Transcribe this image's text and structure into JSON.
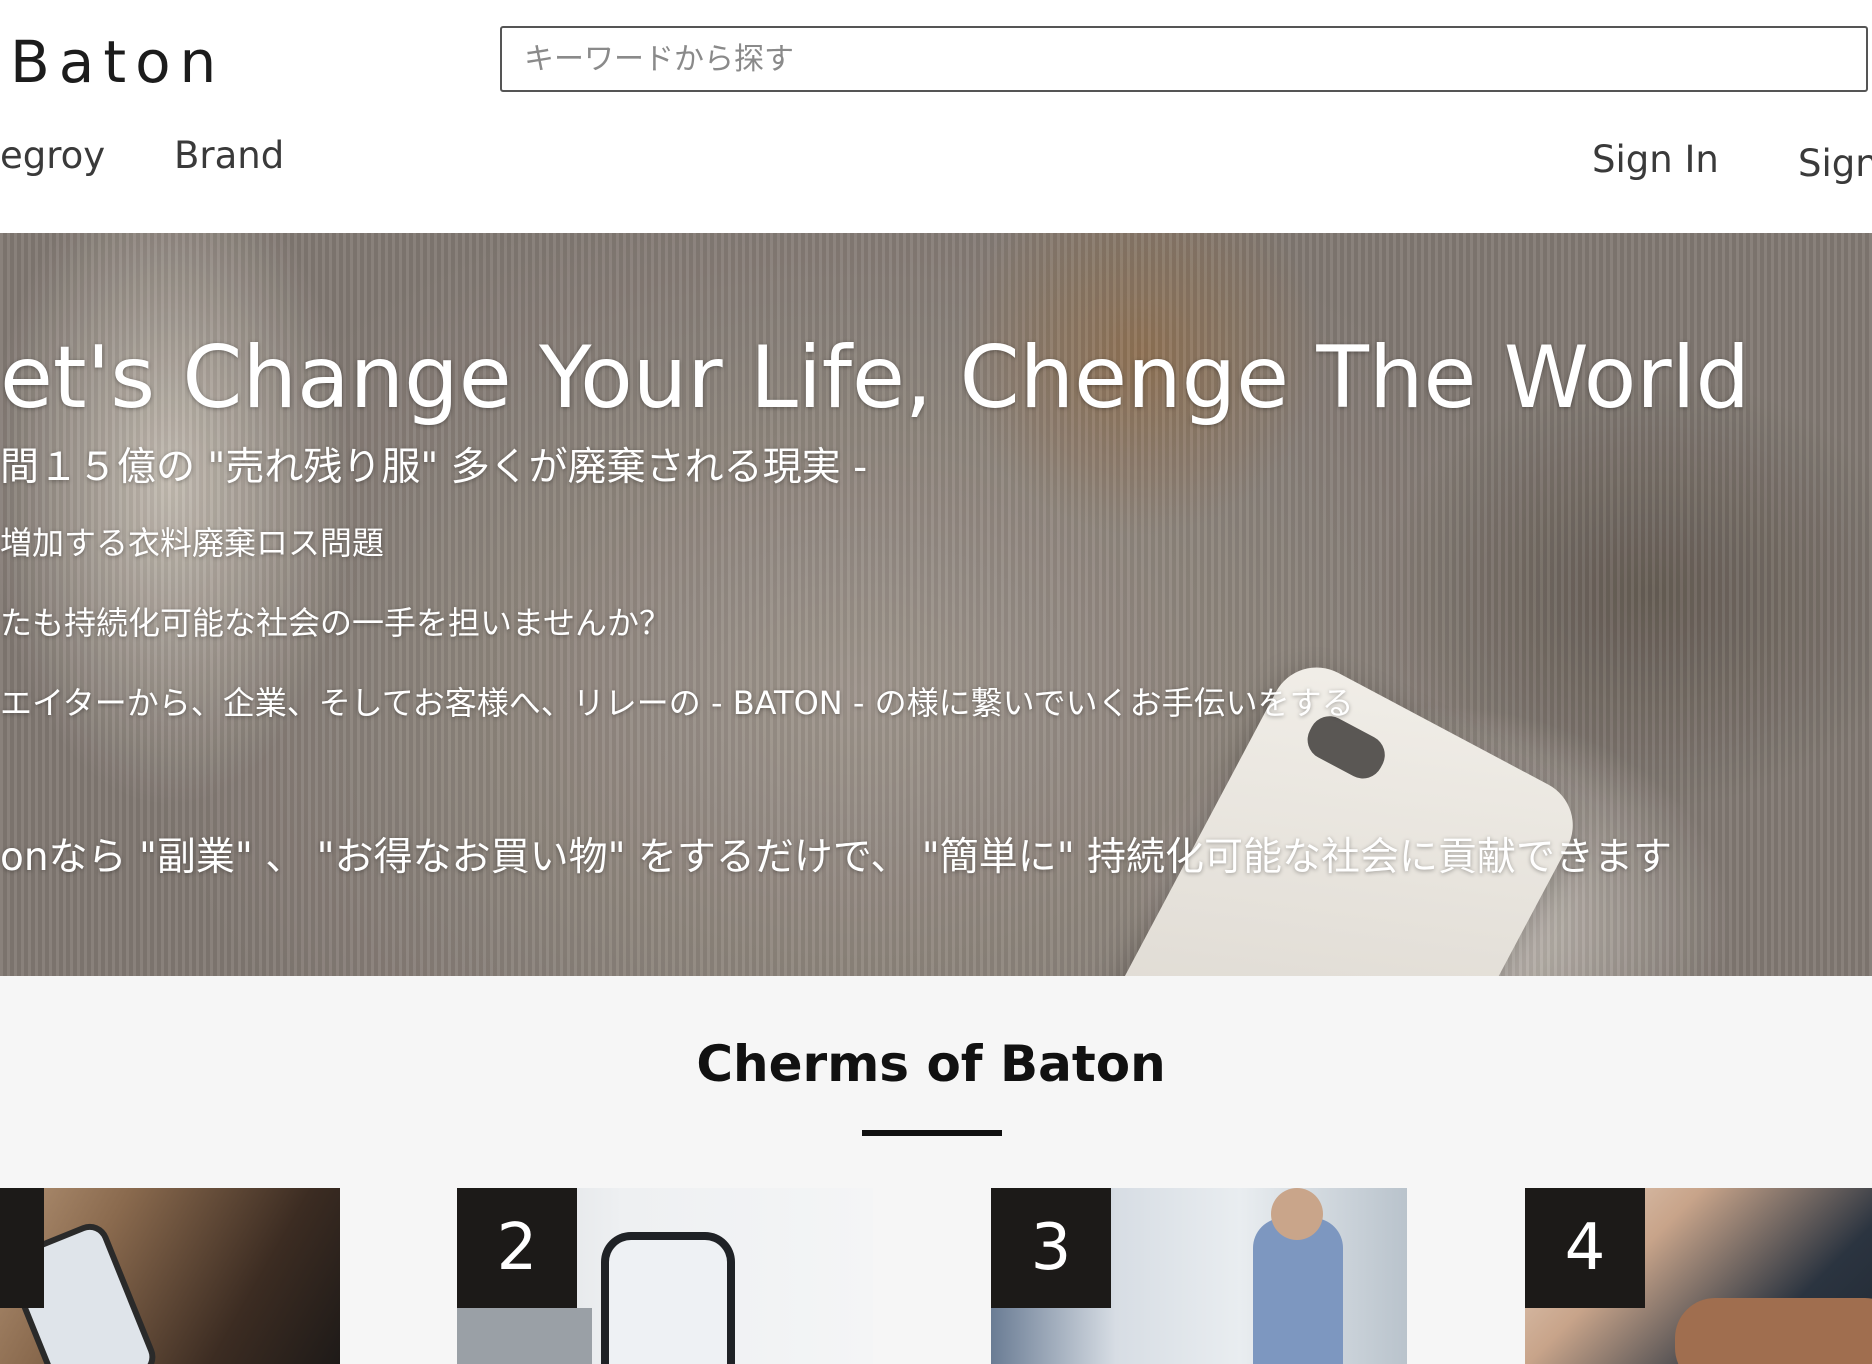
{
  "header": {
    "logo": "Baton",
    "search_placeholder": "キーワードから探す",
    "nav": {
      "category": "egroy",
      "brand": "Brand"
    },
    "auth": {
      "sign_in": "Sign In",
      "sign_up": "Sign"
    }
  },
  "hero": {
    "headline": "et's Change Your Life, Chenge The World",
    "subhead": "間１５億の \"売れ残り服\" 多くが廃棄される現実 -",
    "line1": "増加する衣料廃棄ロス問題",
    "line2": "たも持続化可能な社会の一手を担いませんか？",
    "line3": "エイターから、企業、そしてお客様へ、リレーの - BATON - の様に繋いでいくお手伝いをする",
    "tagline": "onなら \"副業\" 、 \"お得なお買い物\" をするだけで、 \"簡単に\" 持続化可能な社会に貢献できます"
  },
  "charms": {
    "title": "Cherms of Baton",
    "cards": [
      {
        "number": ""
      },
      {
        "number": "2"
      },
      {
        "number": "3"
      },
      {
        "number": "4"
      }
    ]
  }
}
